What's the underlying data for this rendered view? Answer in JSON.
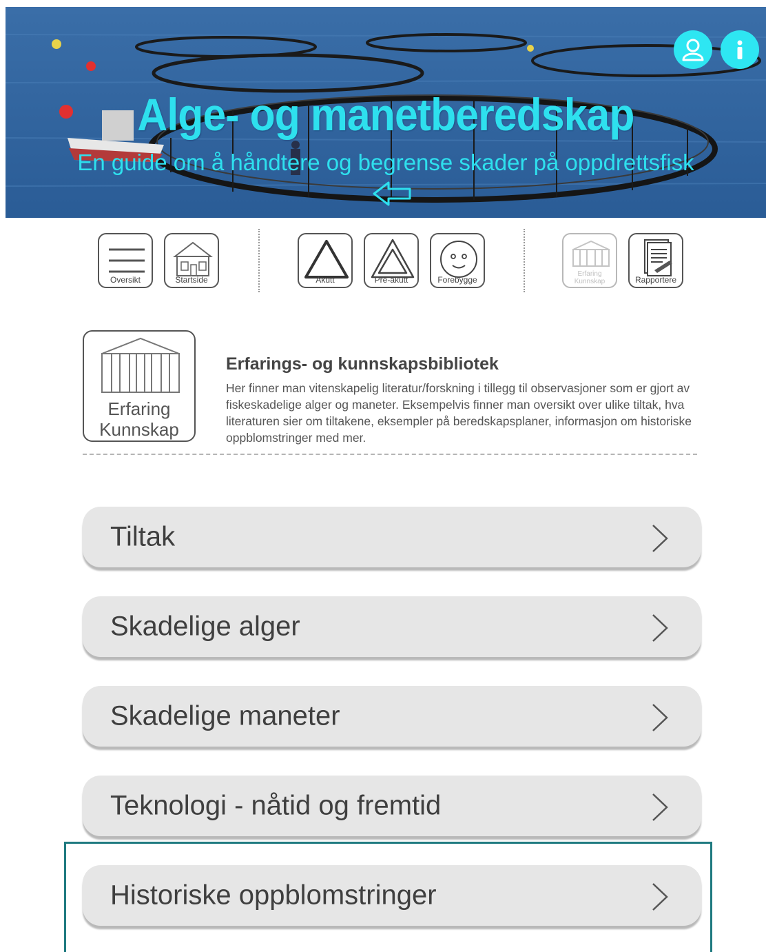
{
  "header": {
    "title": "Alge- og manetberedskap",
    "subtitle": "En guide om å håndtere og begrense skader på oppdrettsfisk",
    "accent_color": "#2ee0ee",
    "icons": {
      "back": "back-arrow-icon",
      "user": "user-icon",
      "info": "info-icon"
    }
  },
  "toolbar": {
    "groups": [
      [
        {
          "label": "Oversikt",
          "icon": "menu-icon"
        },
        {
          "label": "Startside",
          "icon": "home-icon"
        }
      ],
      [
        {
          "label": "Akutt",
          "icon": "triangle-icon"
        },
        {
          "label": "Pre-akutt",
          "icon": "double-triangle-icon"
        },
        {
          "label": "Forebygge",
          "icon": "smiley-icon"
        }
      ],
      [
        {
          "label": "Erfaring Kunnskap",
          "icon": "library-icon",
          "disabled": true
        },
        {
          "label": "Rapportere",
          "icon": "report-icon"
        }
      ]
    ]
  },
  "library": {
    "icon_lines": [
      "Erfaring",
      "Kunnskap"
    ],
    "title": "Erfarings- og kunnskapsbibliotek",
    "description": "Her finner man vitenskapelig literatur/forskning i tillegg til observasjoner som er gjort av fiskeskadelige alger og maneter. Eksempelvis finner man oversikt over ulike tiltak, hva literaturen sier om tiltakene,  eksempler på beredskapsplaner, informasjon om historiske oppblomstringer med mer."
  },
  "menu": [
    {
      "label": "Tiltak"
    },
    {
      "label": "Skadelige alger"
    },
    {
      "label": "Skadelige maneter"
    },
    {
      "label": "Teknologi - nåtid og fremtid"
    },
    {
      "label": "Historiske oppblomstringer",
      "highlighted": true
    }
  ]
}
